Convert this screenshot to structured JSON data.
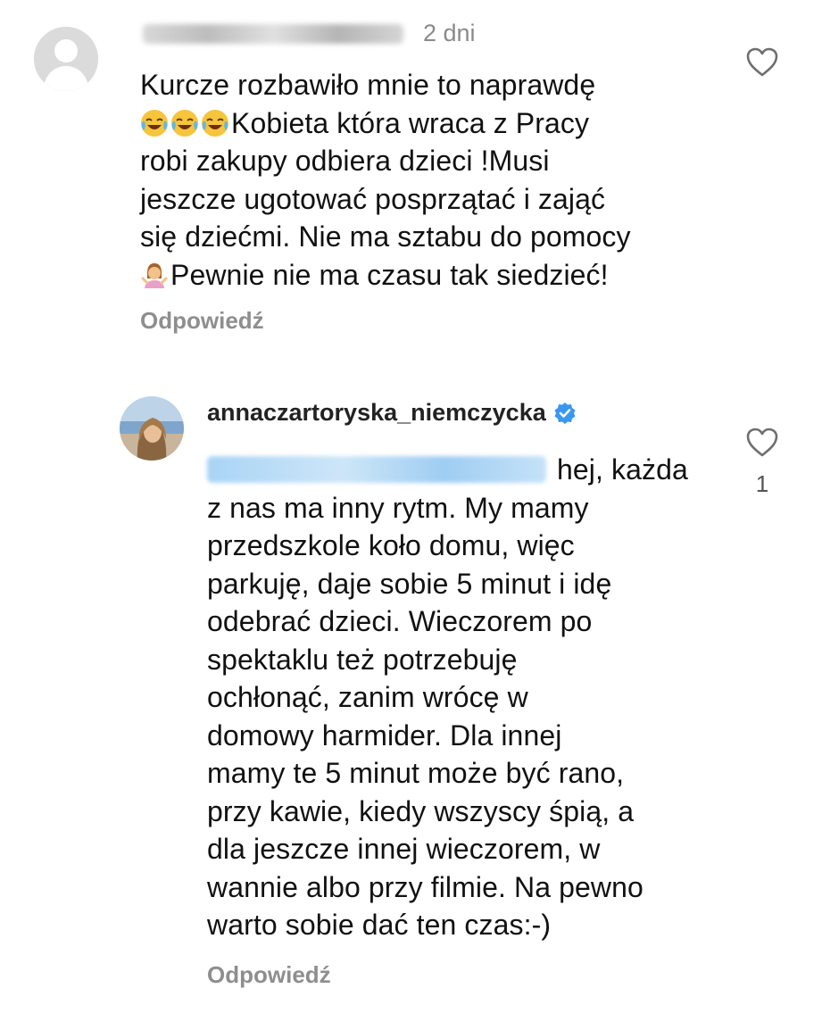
{
  "comments": [
    {
      "username_display": "blurred-username",
      "timestamp": "2 dni",
      "text_lines": [
        "Kurcze rozbawiło mnie to naprawdę",
        "Kobieta która wraca z Pracy",
        "robi zakupy odbiera dzieci !Musi",
        "jeszcze ugotować posprzątać i zająć",
        "się dziećmi. Nie ma sztabu do pomocy",
        "Pewnie nie ma czasu tak siedzieć!"
      ],
      "emojis_line2": [
        "face-with-tears-of-joy-emoji",
        "face-with-tears-of-joy-emoji",
        "face-with-tears-of-joy-emoji"
      ],
      "emoji_line6": "woman-shrugging-emoji",
      "reply_label": "Odpowiedź",
      "like_icon": "heart-icon"
    },
    {
      "username": "annaczartoryska_niemczycka",
      "verified_icon": "verified-badge-icon",
      "text_lines": [
        "hej, każda",
        "z nas ma inny rytm. My mamy",
        "przedszkole koło domu, więc",
        "parkuję, daje sobie 5 minut i idę",
        "odebrać dzieci. Wieczorem po",
        "spektaklu też potrzebuję",
        "ochłonąć, zanim wrócę w",
        "domowy harmider. Dla innej",
        "mamy te 5 minut może być rano,",
        "przy kawie, kiedy wszyscy śpią, a",
        "dla jeszcze innej wieczorem, w",
        "wannie albo przy filmie. Na pewno",
        "warto sobie dać ten czas:-)"
      ],
      "reply_label": "Odpowiedź",
      "like_icon": "heart-icon",
      "like_count": "1"
    }
  ],
  "colors": {
    "text": "#111111",
    "muted": "#8e8e8e",
    "verified_blue": "#3897f0",
    "mention_blue": "#00376b"
  }
}
